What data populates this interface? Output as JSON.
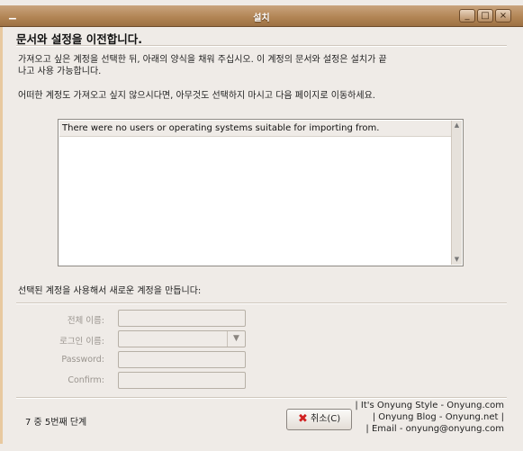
{
  "window": {
    "title": "설치"
  },
  "page": {
    "heading": "문서와 설정을 이전합니다.",
    "description_line1": "가져오고 싶은 계정을 선택한 뒤, 아래의 양식을 채워 주십시오. 이 계정의 문서와 설정은 설치가 끝",
    "description_line2": "나고 사용 가능합니다.",
    "description_line3": "어떠한 계정도 가져오고 싶지 않으시다면, 아무것도 선택하지 마시고 다음 페이지로 이동하세요."
  },
  "list": {
    "empty_message": "There were no users or operating systems suitable for importing from."
  },
  "form": {
    "section_label": "선택된 계정을 사용해서 새로운 계정을 만듭니다:",
    "full_name_label": "전체 이름:",
    "login_name_label": "로그인 이름:",
    "password_label": "Password:",
    "confirm_label": "Confirm:"
  },
  "footer": {
    "step_text": "7 중 5번째 단계",
    "cancel_label": "취소(C)"
  },
  "watermark": {
    "line1": "| It's Onyung Style - Onyung.com",
    "line2": "| Onyung Blog - Onyung.net |",
    "line3": "| Email - onyung@onyung.com"
  }
}
